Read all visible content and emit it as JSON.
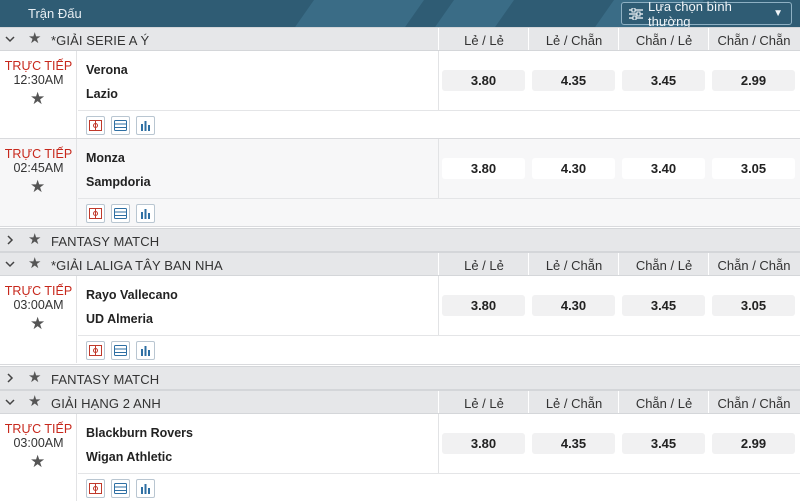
{
  "header": {
    "title": "Trận Đấu",
    "mode_label": "Lựa chọn bình thường"
  },
  "odds_headers": [
    "Lẻ / Lẻ",
    "Lẻ / Chẵn",
    "Chẵn / Lẻ",
    "Chẵn / Chẵn"
  ],
  "leagues": [
    {
      "name": "*Giải Serie A Ý",
      "expanded": true
    },
    {
      "name": "Fantasy Match",
      "expanded": false
    },
    {
      "name": "*Giải LaLiga Tây Ban Nha",
      "expanded": true
    },
    {
      "name": "Fantasy Match",
      "expanded": false
    },
    {
      "name": "Giải Hạng 2 Anh",
      "expanded": true
    }
  ],
  "matches": [
    {
      "status": "TRỰC TIẾP",
      "time": "12:30AM",
      "home": "Verona",
      "away": "Lazio",
      "odds": [
        "3.80",
        "4.35",
        "3.45",
        "2.99"
      ]
    },
    {
      "status": "TRỰC TIẾP",
      "time": "02:45AM",
      "home": "Monza",
      "away": "Sampdoria",
      "odds": [
        "3.80",
        "4.30",
        "3.40",
        "3.05"
      ]
    },
    {
      "status": "TRỰC TIẾP",
      "time": "03:00AM",
      "home": "Rayo Vallecano",
      "away": "UD Almeria",
      "odds": [
        "3.80",
        "4.30",
        "3.45",
        "3.05"
      ]
    },
    {
      "status": "TRỰC TIẾP",
      "time": "03:00AM",
      "home": "Blackburn Rovers",
      "away": "Wigan Athletic",
      "odds": [
        "3.80",
        "4.35",
        "3.45",
        "2.99"
      ]
    }
  ],
  "icons": {
    "field": "pitch-icon",
    "stats": "scoreboard-icon",
    "chart": "bar-chart-icon"
  },
  "colors": {
    "header_bg": "#2f5c74",
    "live_text": "#c7281c",
    "league_bg": "#e6e7e9"
  }
}
